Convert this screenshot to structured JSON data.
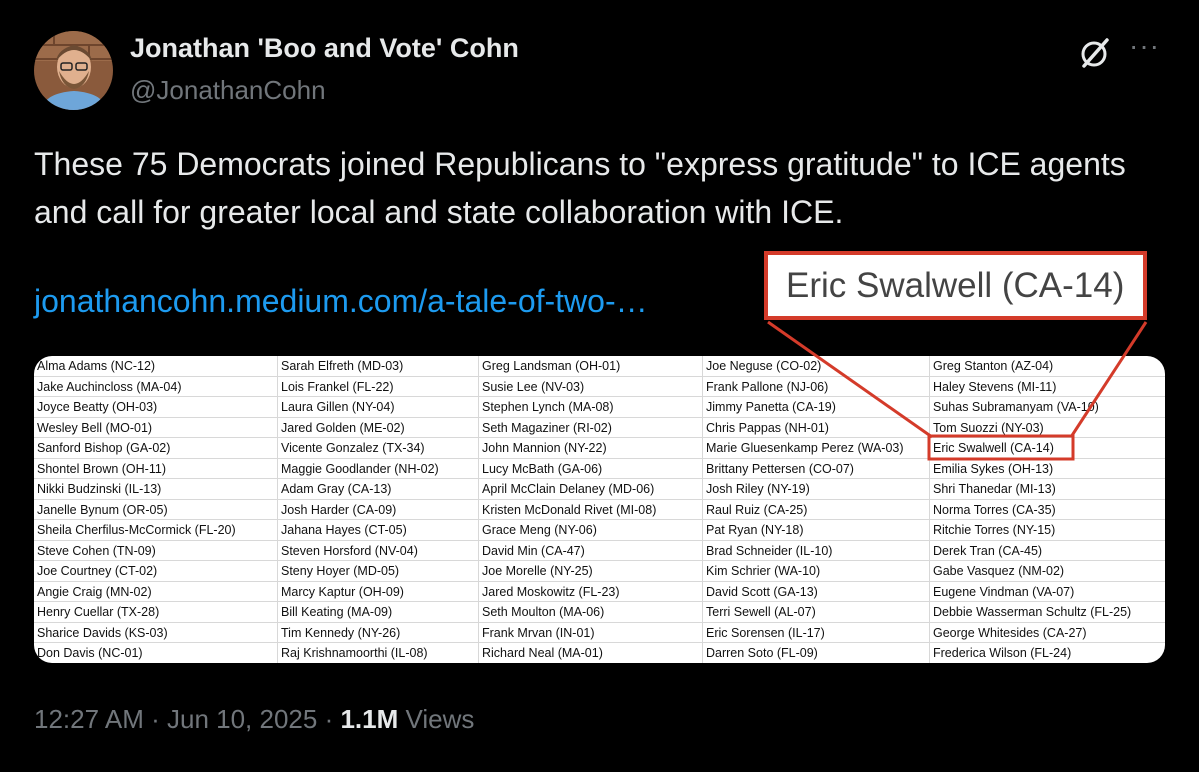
{
  "author": {
    "display_name": "Jonathan 'Boo and Vote' Cohn",
    "handle": "@JonathanCohn"
  },
  "tweet": {
    "text": "These 75 Democrats joined Republicans to \"express gratitude\" to ICE agents and call for greater local and state collaboration with ICE.",
    "link": "jonathancohn.medium.com/a-tale-of-two-…",
    "time": "12:27 AM",
    "date": "Jun 10, 2025",
    "views_count": "1.1M",
    "views_label": "Views"
  },
  "callout": {
    "label": "Eric Swalwell (CA-14)",
    "color": "#d43b2a"
  },
  "icons": [
    "grok-icon",
    "more-options-icon"
  ],
  "table": {
    "columns": [
      [
        "Alma Adams (NC-12)",
        "Jake Auchincloss (MA-04)",
        "Joyce Beatty (OH-03)",
        "Wesley Bell (MO-01)",
        "Sanford Bishop (GA-02)",
        "Shontel Brown (OH-11)",
        "Nikki Budzinski (IL-13)",
        "Janelle Bynum (OR-05)",
        "Sheila Cherfilus-McCormick (FL-20)",
        "Steve Cohen (TN-09)",
        "Joe Courtney (CT-02)",
        "Angie Craig (MN-02)",
        "Henry Cuellar (TX-28)",
        "Sharice Davids (KS-03)",
        "Don Davis (NC-01)"
      ],
      [
        "Sarah Elfreth (MD-03)",
        "Lois Frankel (FL-22)",
        "Laura Gillen (NY-04)",
        "Jared Golden (ME-02)",
        "Vicente Gonzalez (TX-34)",
        "Maggie Goodlander (NH-02)",
        "Adam Gray (CA-13)",
        "Josh Harder (CA-09)",
        "Jahana Hayes (CT-05)",
        "Steven Horsford (NV-04)",
        "Steny Hoyer (MD-05)",
        "Marcy Kaptur (OH-09)",
        "Bill Keating (MA-09)",
        "Tim Kennedy (NY-26)",
        "Raj Krishnamoorthi (IL-08)"
      ],
      [
        "Greg Landsman (OH-01)",
        "Susie Lee (NV-03)",
        "Stephen Lynch (MA-08)",
        "Seth Magaziner (RI-02)",
        "John Mannion (NY-22)",
        "Lucy McBath (GA-06)",
        "April McClain Delaney (MD-06)",
        "Kristen McDonald Rivet (MI-08)",
        "Grace Meng (NY-06)",
        "David Min (CA-47)",
        "Joe Morelle (NY-25)",
        "Jared Moskowitz (FL-23)",
        "Seth Moulton (MA-06)",
        "Frank Mrvan (IN-01)",
        "Richard Neal (MA-01)"
      ],
      [
        "Joe Neguse (CO-02)",
        "Frank Pallone (NJ-06)",
        "Jimmy Panetta (CA-19)",
        "Chris Pappas (NH-01)",
        "Marie Gluesenkamp Perez (WA-03)",
        "Brittany Pettersen (CO-07)",
        "Josh Riley (NY-19)",
        "Raul Ruiz (CA-25)",
        "Pat Ryan (NY-18)",
        "Brad Schneider (IL-10)",
        "Kim Schrier (WA-10)",
        "David Scott (GA-13)",
        "Terri Sewell (AL-07)",
        "Eric Sorensen (IL-17)",
        "Darren Soto (FL-09)"
      ],
      [
        "Greg Stanton (AZ-04)",
        "Haley Stevens (MI-11)",
        "Suhas Subramanyam (VA-10)",
        "Tom Suozzi (NY-03)",
        "Eric Swalwell (CA-14)",
        "Emilia Sykes (OH-13)",
        "Shri Thanedar (MI-13)",
        "Norma Torres (CA-35)",
        "Ritchie Torres (NY-15)",
        "Derek Tran (CA-45)",
        "Gabe Vasquez (NM-02)",
        "Eugene Vindman (VA-07)",
        "Debbie Wasserman Schultz (FL-25)",
        "George Whitesides (CA-27)",
        "Frederica Wilson (FL-24)"
      ]
    ]
  }
}
